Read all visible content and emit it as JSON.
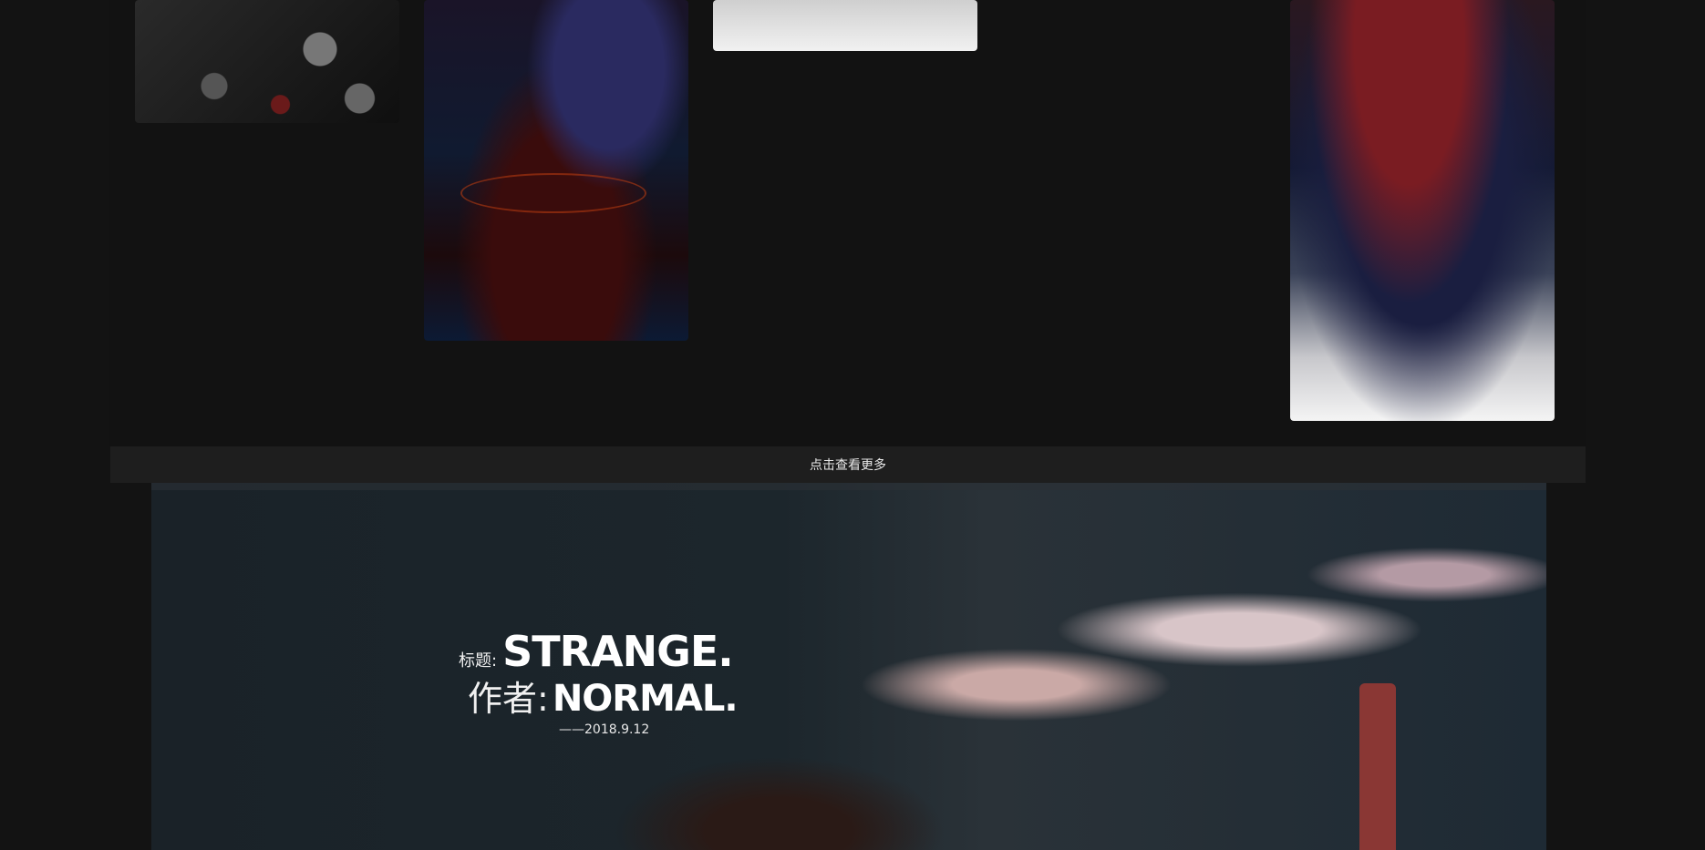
{
  "more": {
    "label": "点击查看更多"
  },
  "feature": {
    "title_label": "标题:",
    "title_value": "STRANGE.",
    "author_label": "作者:",
    "author_value": "NORMAL.",
    "date": "——2018.9.12"
  }
}
